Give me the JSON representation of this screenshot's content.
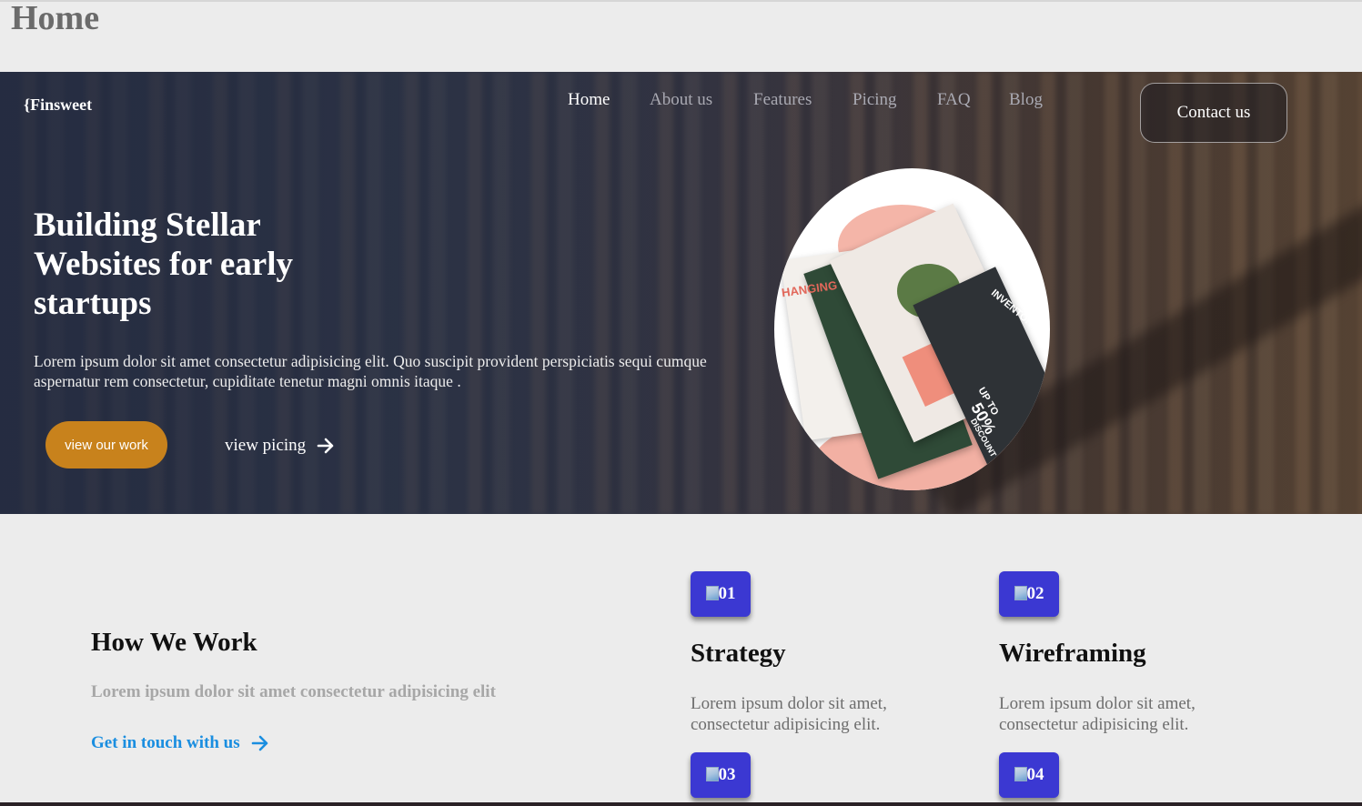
{
  "page": {
    "heading": "Home"
  },
  "header": {
    "logo": "{Finsweet",
    "nav": [
      {
        "label": "Home",
        "active": true
      },
      {
        "label": "About us",
        "active": false
      },
      {
        "label": "Features",
        "active": false
      },
      {
        "label": "Picing",
        "active": false
      },
      {
        "label": "FAQ",
        "active": false
      },
      {
        "label": "Blog",
        "active": false
      }
    ],
    "contact_label": "Contact us"
  },
  "hero": {
    "title": "Building Stellar Websites for early startups",
    "description": "Lorem ipsum dolor sit amet consectetur adipisicing elit. Quo suscipit provident perspiciatis sequi cumque aspernatur rem consectetur, cupiditate tenetur magni omnis itaque .",
    "primary_button": "view our work",
    "secondary_link": "view picing",
    "image_text": {
      "hanging": "HANGING",
      "inventory": "INVENTORY",
      "upto": "UP TO",
      "percent": "50%",
      "discount": "DISCOUNT"
    }
  },
  "how_we_work": {
    "title": "How We Work",
    "subtitle": "Lorem ipsum dolor sit amet consectetur adipisicing elit",
    "link": "Get in touch with us"
  },
  "steps": [
    {
      "number": "01",
      "title": "Strategy",
      "description": "Lorem ipsum dolor sit amet, consectetur adipisicing elit."
    },
    {
      "number": "02",
      "title": "Wireframing",
      "description": "Lorem ipsum dolor sit amet, consectetur adipisicing elit."
    },
    {
      "number": "03"
    },
    {
      "number": "04"
    }
  ],
  "colors": {
    "accent_orange": "#c8821c",
    "badge_blue": "#3b38d2",
    "link_blue": "#1a8ee0",
    "hero_dark": "#2c3349"
  }
}
